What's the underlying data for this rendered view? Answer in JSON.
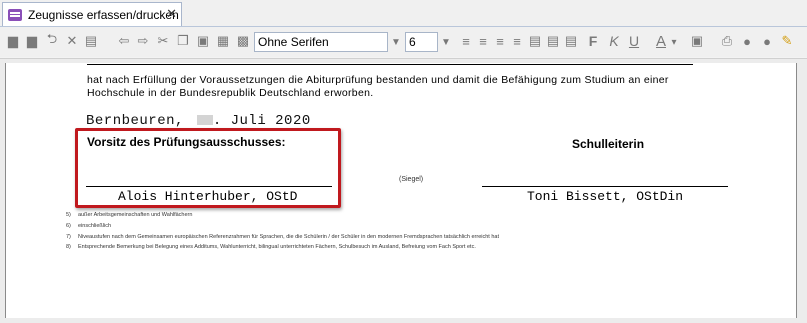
{
  "tab": {
    "title": "Zeugnisse erfassen/drucken",
    "close": "✕"
  },
  "toolbar": {
    "font_name": "Ohne Serifen",
    "font_size": "6",
    "bold": "F",
    "italic": "K",
    "underline": "U",
    "font_color": "A",
    "icons": [
      "save-icon",
      "save-all-icon",
      "undo-icon",
      "delete-icon",
      "print-preview-icon",
      "arrow-left-icon",
      "arrow-right-icon",
      "cut-icon",
      "copy-icon",
      "paste-icon",
      "insert-field-icon",
      "insert-table-icon",
      "align-left-icon",
      "align-center-icon",
      "align-right-icon",
      "justify-icon",
      "indent-icon",
      "outdent-icon",
      "zoom-icon",
      "print-icon",
      "preview-icon",
      "settings-icon",
      "brush-icon"
    ]
  },
  "document": {
    "intro_line1": "hat nach Erfüllung der Voraussetzungen die Abiturprüfung bestanden und damit die Befähigung zum Studium an einer",
    "intro_line2": "Hochschule in der Bundesrepublik Deutschland erworben.",
    "date_place": "Bernbeuren,",
    "date_rest": ". Juli 2020",
    "chair_label": "Vorsitz des Prüfungsausschusses:",
    "principal_label": "Schulleiterin",
    "seal": "(Siegel)",
    "chair_name": "Alois Hinterhuber, OStD",
    "principal_name": "Toni Bissett, OStDin",
    "footnotes": [
      {
        "num": "5)",
        "text": "außer Arbeitsgemeinschaften und Wahlfächern"
      },
      {
        "num": "6)",
        "text": "einschließlich"
      },
      {
        "num": "7)",
        "text": "Niveaustufen nach dem Gemeinsamen europäischen Referenzrahmen für Sprachen, die die Schülerin / der Schüler in den modernen Fremdsprachen tatsächlich erreicht hat"
      },
      {
        "num": "8)",
        "text": "Entsprechende Bemerkung bei Belegung eines Additums, Wahlunterricht, bilingual unterrichteten Fächern, Schulbesuch im Ausland, Befreiung vom Fach Sport etc."
      }
    ]
  }
}
